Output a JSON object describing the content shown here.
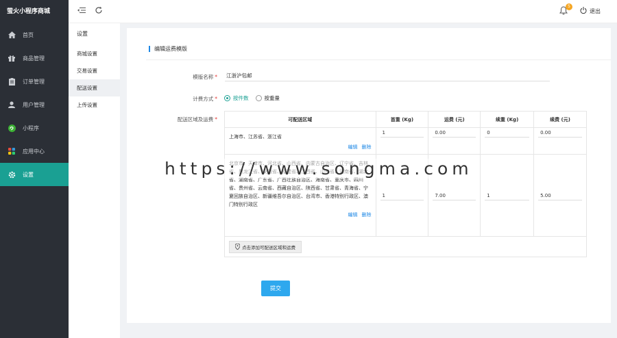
{
  "app": {
    "title": "萤火小程序商城"
  },
  "sidebar": {
    "items": [
      {
        "label": "首页",
        "icon": "home-icon"
      },
      {
        "label": "商品管理",
        "icon": "gift-icon"
      },
      {
        "label": "订单管理",
        "icon": "clipboard-icon"
      },
      {
        "label": "用户管理",
        "icon": "user-icon"
      },
      {
        "label": "小程序",
        "icon": "miniapp-icon"
      },
      {
        "label": "应用中心",
        "icon": "apps-icon"
      },
      {
        "label": "设置",
        "icon": "gear-icon",
        "active": true
      }
    ]
  },
  "subnav": {
    "title": "设置",
    "items": [
      "商城设置",
      "交易设置",
      "配送设置",
      "上传设置"
    ],
    "active_index": 2
  },
  "topbar": {
    "notification_count": "5",
    "logout_label": "退出"
  },
  "form": {
    "title": "编辑运费模版",
    "name_label": "模版名称",
    "name_value": "江浙沪包邮",
    "billing_label": "计费方式",
    "billing_options": [
      "按件数",
      "按重量"
    ],
    "billing_selected": 0,
    "region_label": "配送区域及运费",
    "table": {
      "headers": [
        "可配送区域",
        "首重 (Kg)",
        "运费 (元)",
        "续重 (Kg)",
        "续费 (元)"
      ],
      "rows": [
        {
          "regions": "上海市、江苏省、浙江省",
          "first": "1",
          "fee": "0.00",
          "extra": "0",
          "extra_fee": "0.00"
        },
        {
          "regions": "北京市、天津市、河北省、山西省、内蒙古自治区、辽宁省、吉林省、黑龙江省、安徽省、福建省、江西省、山东省、河南省、湖北省、湖南省、广东省、广西壮族自治区、海南省、重庆市、四川省、贵州省、云南省、西藏自治区、陕西省、甘肃省、青海省、宁夏回族自治区、新疆维吾尔自治区、台湾市、香港特别行政区、澳门特别行政区",
          "first": "1",
          "fee": "7.00",
          "extra": "1",
          "extra_fee": "5.00"
        }
      ],
      "edit_label": "编辑",
      "delete_label": "删除",
      "add_label": "点击添加可配送区域和运费"
    },
    "submit_label": "提交"
  },
  "watermark": "https://www.songma.com",
  "colors": {
    "accent": "#1aa093",
    "primary": "#2ea8ee",
    "sidebar_bg": "#2b2f36"
  }
}
